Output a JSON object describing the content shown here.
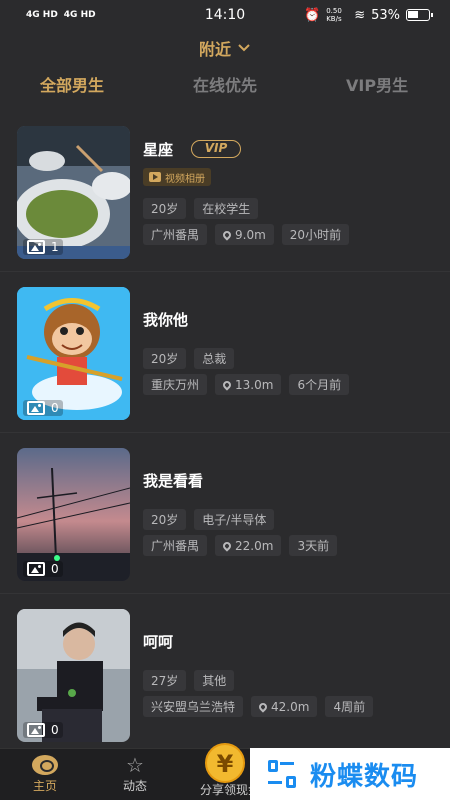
{
  "status": {
    "signal1": "4G HD",
    "signal2": "4G HD",
    "time": "14:10",
    "speed": "0.50 KB/s",
    "battery": "53%"
  },
  "header": {
    "location": "附近"
  },
  "tabs": [
    {
      "label": "全部男生",
      "active": true
    },
    {
      "label": "在线优先",
      "active": false
    },
    {
      "label": "VIP男生",
      "active": false
    }
  ],
  "users": [
    {
      "name": "星座",
      "vip": "VIP",
      "video_album": "视频相册",
      "age": "20岁",
      "job": "在校学生",
      "city": "广州番禺",
      "distance": "9.0m",
      "time": "20小时前",
      "photos": "1"
    },
    {
      "name": "我你他",
      "age": "20岁",
      "job": "总裁",
      "city": "重庆万州",
      "distance": "13.0m",
      "time": "6个月前",
      "photos": "0"
    },
    {
      "name": "我是看看",
      "age": "20岁",
      "job": "电子/半导体",
      "city": "广州番禺",
      "distance": "22.0m",
      "time": "3天前",
      "photos": "0"
    },
    {
      "name": "呵呵",
      "age": "27岁",
      "job": "其他",
      "city": "兴安盟乌兰浩特",
      "distance": "42.0m",
      "time": "4周前",
      "photos": "0"
    }
  ],
  "nav": {
    "home": "主页",
    "moments": "动态",
    "share": "分享领现金",
    "coin": "¥"
  },
  "watermark": {
    "text": "粉蝶数码"
  },
  "colors": {
    "accent": "#d3a85e",
    "background": "#2b2b2d"
  }
}
